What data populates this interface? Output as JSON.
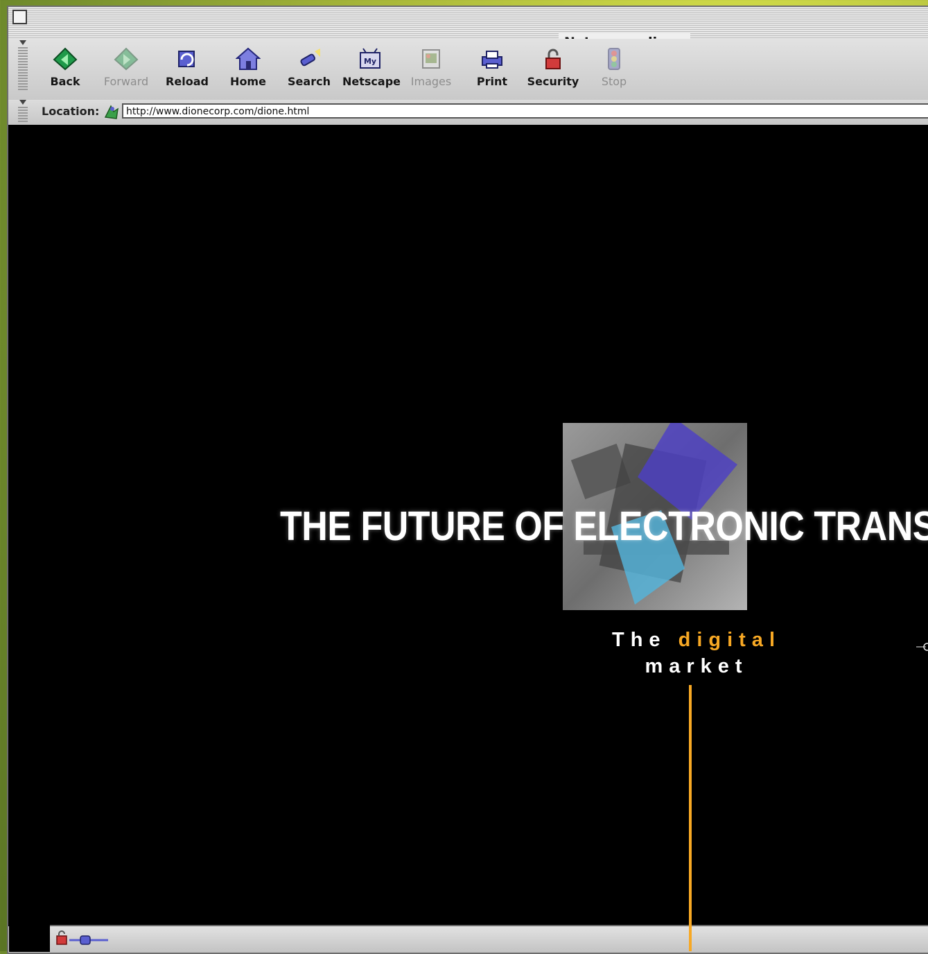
{
  "window": {
    "title": "Netscape: dione"
  },
  "toolbar": {
    "buttons": [
      {
        "label": "Back",
        "icon": "back-arrow-icon",
        "enabled": true
      },
      {
        "label": "Forward",
        "icon": "forward-arrow-icon",
        "enabled": false
      },
      {
        "label": "Reload",
        "icon": "reload-icon",
        "enabled": true
      },
      {
        "label": "Home",
        "icon": "home-icon",
        "enabled": true
      },
      {
        "label": "Search",
        "icon": "search-flashlight-icon",
        "enabled": true
      },
      {
        "label": "Netscape",
        "icon": "my-netscape-icon",
        "enabled": true
      },
      {
        "label": "Images",
        "icon": "images-icon",
        "enabled": false
      },
      {
        "label": "Print",
        "icon": "printer-icon",
        "enabled": true
      },
      {
        "label": "Security",
        "icon": "padlock-icon",
        "enabled": true
      },
      {
        "label": "Stop",
        "icon": "stop-traffic-light-icon",
        "enabled": false
      }
    ],
    "netscape_icon_text": "My"
  },
  "location": {
    "label": "Location:",
    "url": "http://www.dionecorp.com/dione.html"
  },
  "page": {
    "headline": "THE FUTURE OF ELECTRONIC TRANSACTI",
    "tagline_the": "The",
    "tagline_accent": "digital",
    "tagline_market": "market"
  },
  "colors": {
    "accent": "#f7a824",
    "page_background": "#000000",
    "chrome": "#d4d4d4"
  }
}
